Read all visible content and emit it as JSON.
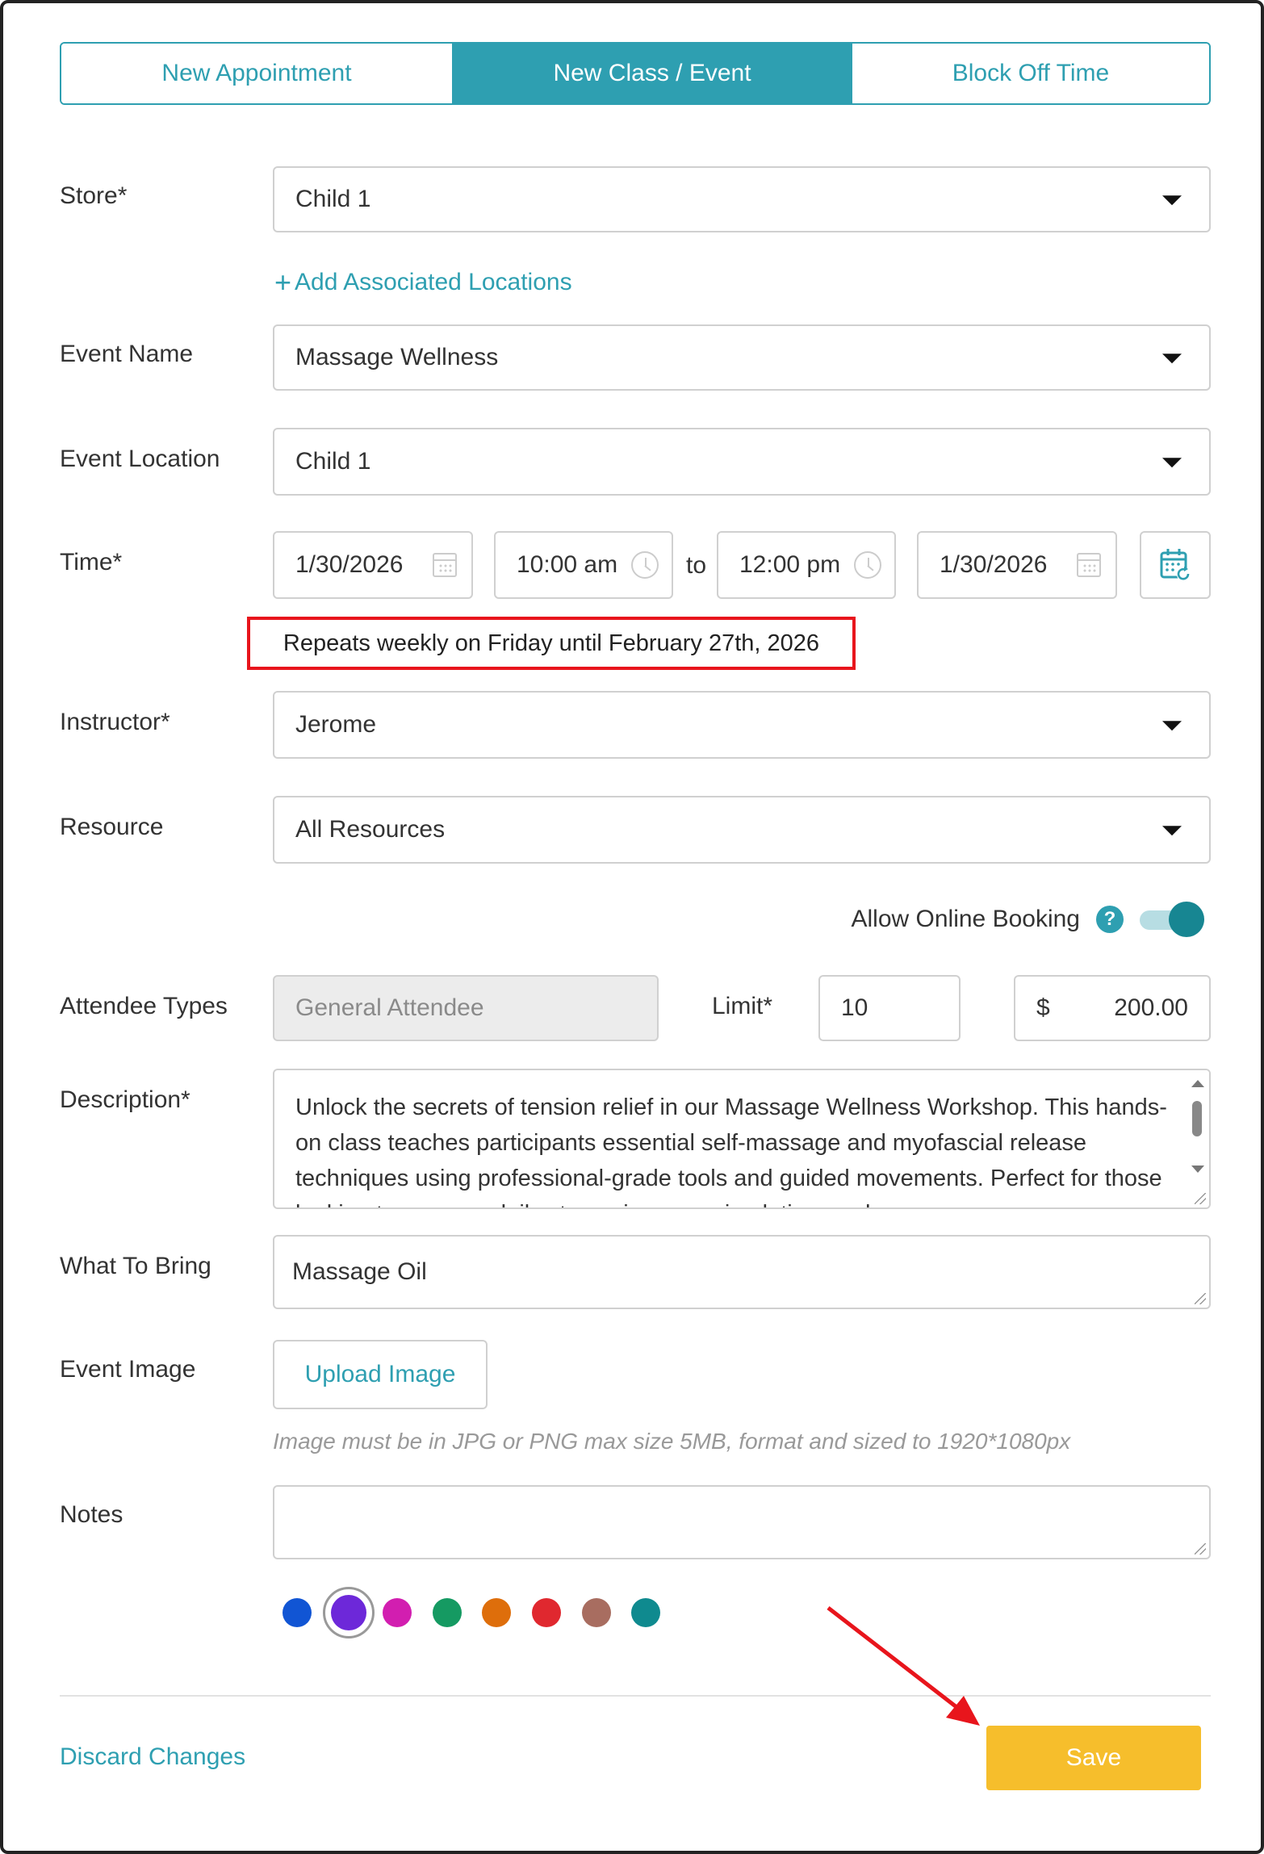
{
  "tabs": [
    {
      "label": "New Appointment",
      "active": false
    },
    {
      "label": "New Class / Event",
      "active": true
    },
    {
      "label": "Block Off Time",
      "active": false
    }
  ],
  "form": {
    "store": {
      "label": "Store*",
      "value": "Child 1"
    },
    "add_locations_label": "Add Associated Locations",
    "event_name": {
      "label": "Event Name",
      "value": "Massage Wellness"
    },
    "event_location": {
      "label": "Event Location",
      "value": "Child 1"
    },
    "time": {
      "label": "Time*",
      "start_date": "1/30/2026",
      "start_time": "10:00 am",
      "to_label": "to",
      "end_time": "12:00 pm",
      "end_date": "1/30/2026",
      "repeat_text": "Repeats weekly on Friday until February 27th, 2026"
    },
    "instructor": {
      "label": "Instructor*",
      "value": "Jerome"
    },
    "resource": {
      "label": "Resource",
      "value": "All Resources"
    },
    "online_booking": {
      "label": "Allow Online Booking",
      "help_glyph": "?",
      "enabled": true
    },
    "attendee_types": {
      "label": "Attendee Types",
      "value": "General Attendee"
    },
    "limit": {
      "label": "Limit*",
      "value": "10"
    },
    "price": {
      "currency": "$",
      "value": "200.00"
    },
    "description": {
      "label": "Description*",
      "value": "Unlock the secrets of tension relief in our Massage Wellness Workshop. This hands-on class teaches participants essential self-massage and myofascial release techniques using professional-grade tools and guided movements. Perfect for those looking to manage daily stress, improve circulation, and"
    },
    "what_to_bring": {
      "label": "What To Bring",
      "value": "Massage Oil"
    },
    "event_image": {
      "label": "Event Image",
      "button_label": "Upload Image",
      "hint": "Image must be in JPG or PNG max size 5MB, format and sized to 1920*1080px"
    },
    "notes": {
      "label": "Notes",
      "value": ""
    },
    "colors": [
      "#1155d4",
      "#6d28d9",
      "#d21eb0",
      "#159a62",
      "#de6e0b",
      "#e0282f",
      "#a86d60",
      "#0f8a8f"
    ],
    "selected_color_index": 1
  },
  "footer": {
    "discard_label": "Discard Changes",
    "save_label": "Save"
  },
  "theme": {
    "accent": "#2e9fb1",
    "save": "#f6be2c",
    "highlight": "#e8151c"
  }
}
